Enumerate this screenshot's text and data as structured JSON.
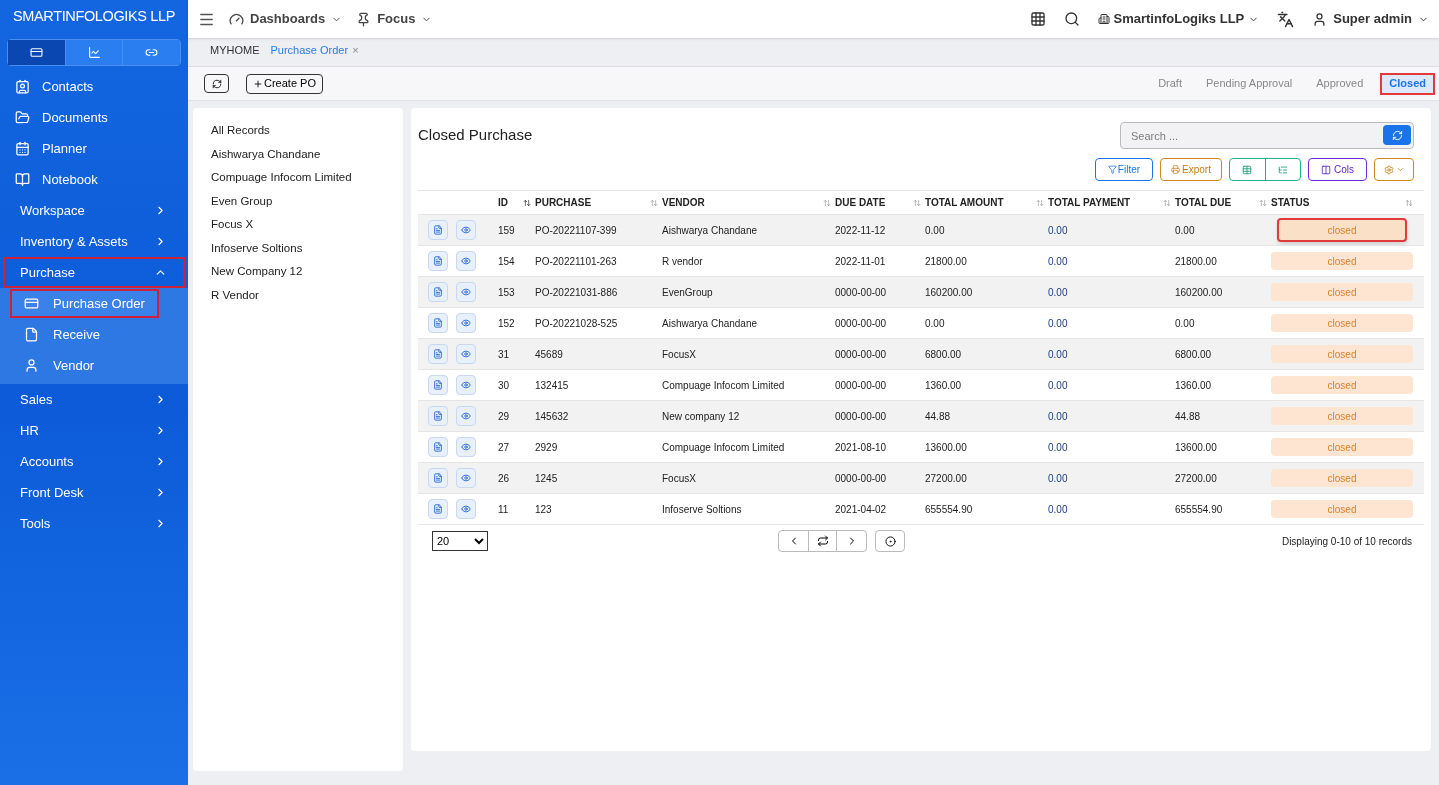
{
  "brand": "SMARTINFOLOGIKS LLP",
  "sidebar": {
    "tabs": [
      {
        "selected": true
      },
      {
        "selected": false
      },
      {
        "selected": false
      }
    ],
    "items": [
      {
        "label": "Contacts",
        "kind": "link"
      },
      {
        "label": "Documents",
        "kind": "link"
      },
      {
        "label": "Planner",
        "kind": "link"
      },
      {
        "label": "Notebook",
        "kind": "link"
      },
      {
        "label": "Workspace",
        "kind": "group",
        "expanded": false,
        "highlighted": false
      },
      {
        "label": "Inventory & Assets",
        "kind": "group",
        "expanded": false,
        "highlighted": false
      },
      {
        "label": "Purchase",
        "kind": "group",
        "expanded": true,
        "highlighted": true,
        "children": [
          {
            "label": "Purchase Order",
            "highlighted": true
          },
          {
            "label": "Receive",
            "highlighted": false
          },
          {
            "label": "Vendor",
            "highlighted": false
          }
        ]
      },
      {
        "label": "Sales",
        "kind": "group",
        "expanded": false,
        "highlighted": false
      },
      {
        "label": "HR",
        "kind": "group",
        "expanded": false,
        "highlighted": false
      },
      {
        "label": "Accounts",
        "kind": "group",
        "expanded": false,
        "highlighted": false
      },
      {
        "label": "Front Desk",
        "kind": "group",
        "expanded": false,
        "highlighted": false
      },
      {
        "label": "Tools",
        "kind": "group",
        "expanded": false,
        "highlighted": false
      }
    ]
  },
  "topbar": {
    "menus": [
      {
        "label": "Dashboards"
      },
      {
        "label": "Focus"
      }
    ],
    "company": "SmartinfoLogiks LLP",
    "user": "Super admin"
  },
  "breadcrumb": {
    "home": "MYHOME",
    "current": "Purchase Order",
    "close": "×"
  },
  "toolbar": {
    "create": "Create PO",
    "status_tabs": [
      {
        "label": "Draft",
        "selected": false
      },
      {
        "label": "Pending Approval",
        "selected": false
      },
      {
        "label": "Approved",
        "selected": false
      },
      {
        "label": "Closed",
        "selected": true
      }
    ]
  },
  "filters": [
    "All Records",
    "Aishwarya Chandane",
    "Compuage Infocom Limited",
    "Even Group",
    "Focus X",
    "Infoserve Soltions",
    "New Company 12",
    "R Vendor"
  ],
  "panel": {
    "title": "Closed Purchase",
    "search_placeholder": "Search ...",
    "buttons": {
      "filter": "Filter",
      "export": "Export",
      "cols": "Cols"
    }
  },
  "table": {
    "columns": [
      "ID",
      "PURCHASE",
      "VENDOR",
      "DUE DATE",
      "TOTAL AMOUNT",
      "TOTAL PAYMENT",
      "TOTAL DUE",
      "STATUS"
    ],
    "rows": [
      {
        "cells": [
          "159",
          "PO-20221107-399",
          "Aishwarya Chandane",
          "2022-11-12",
          "0.00",
          "0.00",
          "0.00"
        ],
        "status": "closed",
        "highlighted": true
      },
      {
        "cells": [
          "154",
          "PO-20221101-263",
          "R vendor",
          "2022-11-01",
          "21800.00",
          "0.00",
          "21800.00"
        ],
        "status": "closed",
        "highlighted": false
      },
      {
        "cells": [
          "153",
          "PO-20221031-886",
          "EvenGroup",
          "0000-00-00",
          "160200.00",
          "0.00",
          "160200.00"
        ],
        "status": "closed",
        "highlighted": false
      },
      {
        "cells": [
          "152",
          "PO-20221028-525",
          "Aishwarya Chandane",
          "0000-00-00",
          "0.00",
          "0.00",
          "0.00"
        ],
        "status": "closed",
        "highlighted": false
      },
      {
        "cells": [
          "31",
          "45689",
          "FocusX",
          "0000-00-00",
          "6800.00",
          "0.00",
          "6800.00"
        ],
        "status": "closed",
        "highlighted": false
      },
      {
        "cells": [
          "30",
          "132415",
          "Compuage Infocom Limited",
          "0000-00-00",
          "1360.00",
          "0.00",
          "1360.00"
        ],
        "status": "closed",
        "highlighted": false
      },
      {
        "cells": [
          "29",
          "145632",
          "New company 12",
          "0000-00-00",
          "44.88",
          "0.00",
          "44.88"
        ],
        "status": "closed",
        "highlighted": false
      },
      {
        "cells": [
          "27",
          "2929",
          "Compuage Infocom Limited",
          "2021-08-10",
          "13600.00",
          "0.00",
          "13600.00"
        ],
        "status": "closed",
        "highlighted": false
      },
      {
        "cells": [
          "26",
          "1245",
          "FocusX",
          "0000-00-00",
          "27200.00",
          "0.00",
          "27200.00"
        ],
        "status": "closed",
        "highlighted": false
      },
      {
        "cells": [
          "11",
          "123",
          "Infoserve Soltions",
          "2021-04-02",
          "655554.90",
          "0.00",
          "655554.90"
        ],
        "status": "closed",
        "highlighted": false
      }
    ]
  },
  "pager": {
    "page_size": "20",
    "summary": "Displaying 0-10 of 10 records"
  }
}
